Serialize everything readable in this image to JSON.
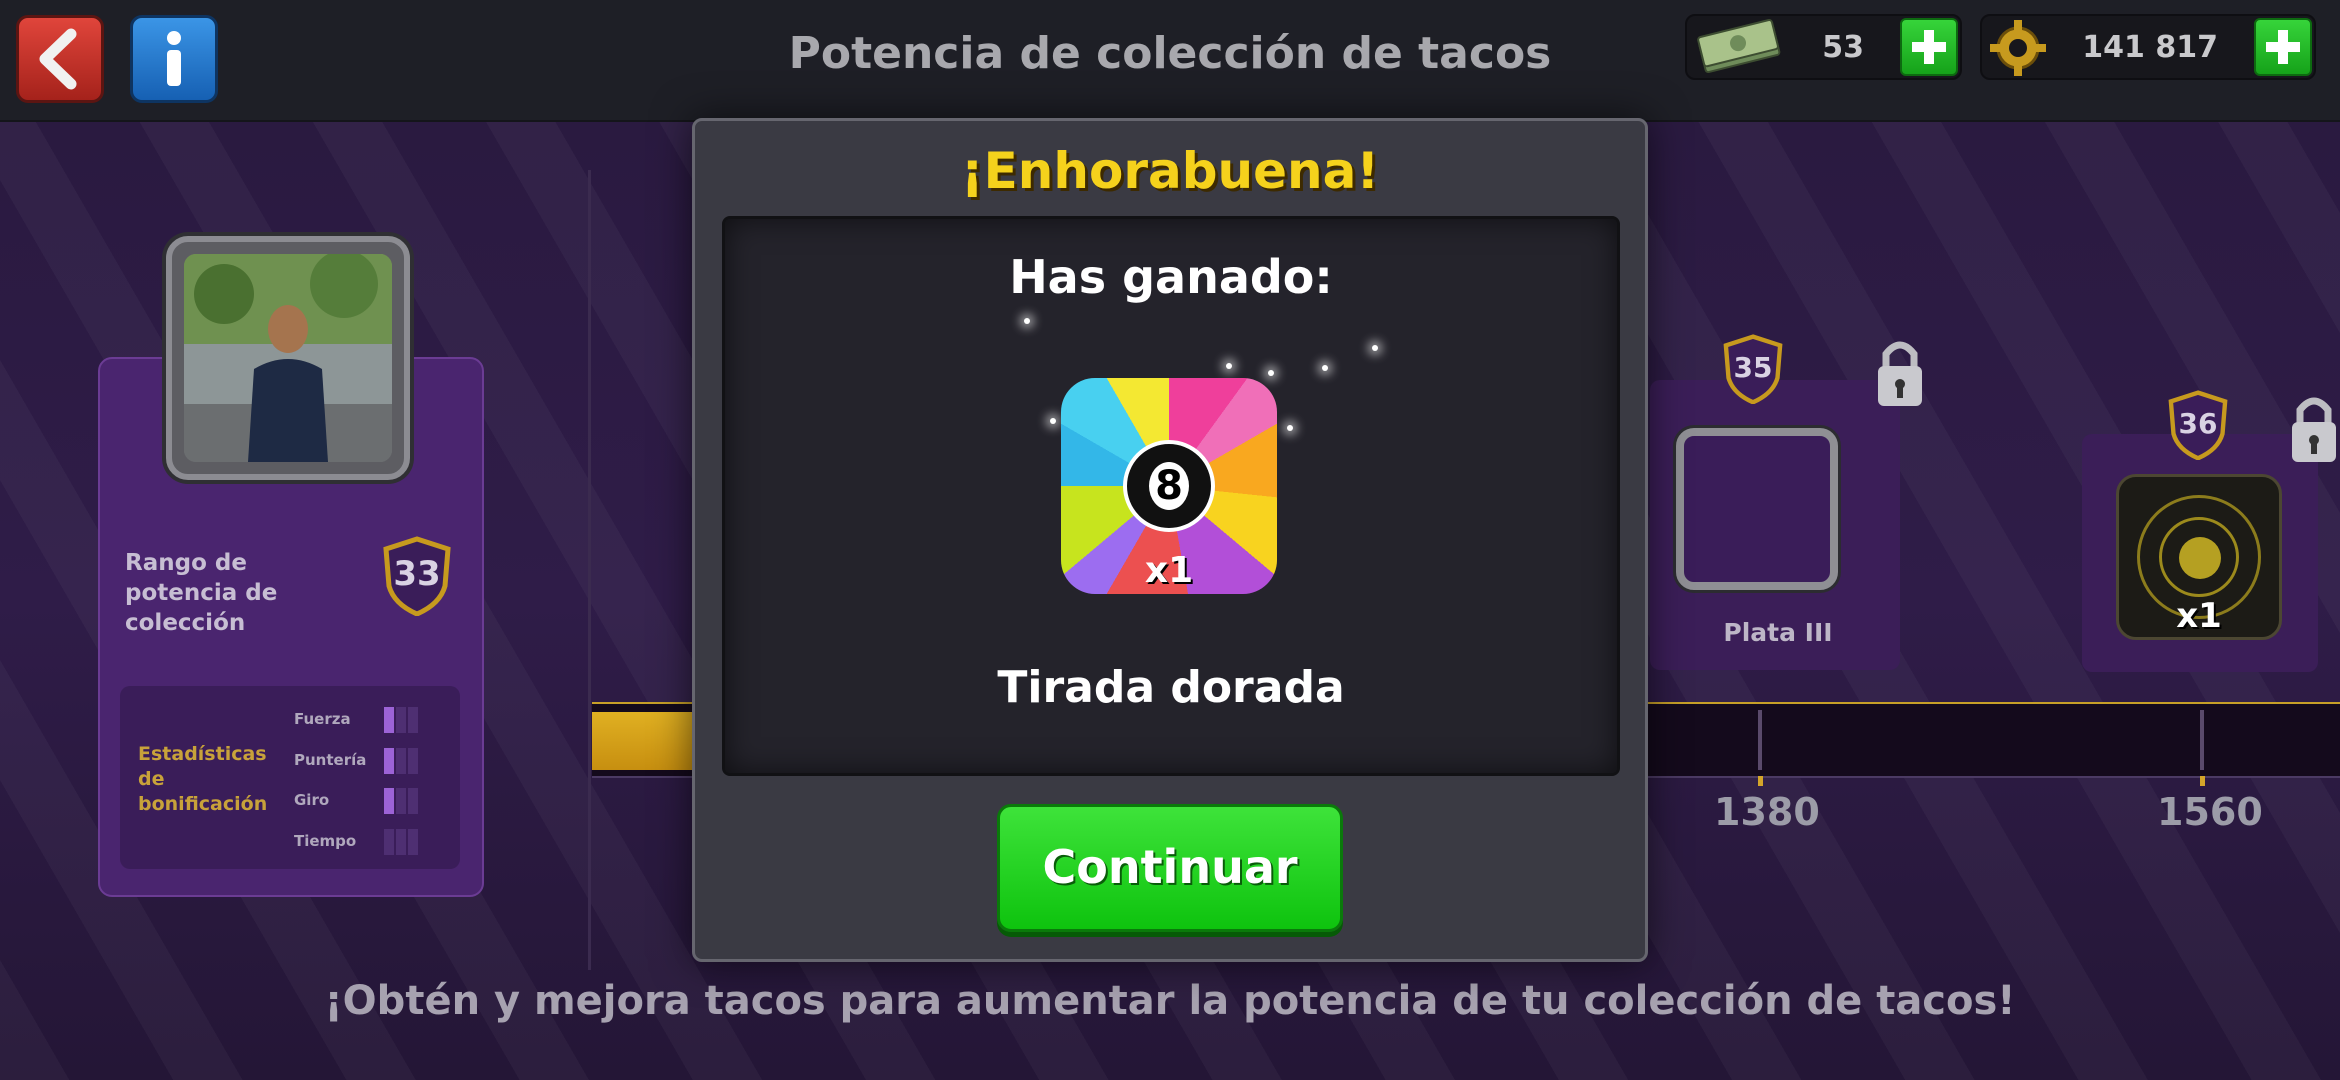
{
  "header": {
    "title": "Potencia de colección de tacos",
    "cash": "53",
    "coins": "141 817"
  },
  "profile": {
    "rank_label": "Rango de potencia de colección",
    "rank_value": "33",
    "bonus_label": "Estadísticas de bonificación",
    "stats": [
      {
        "name": "Fuerza",
        "level": 1
      },
      {
        "name": "Puntería",
        "level": 1
      },
      {
        "name": "Giro",
        "level": 1
      },
      {
        "name": "Tiempo",
        "level": 0
      }
    ]
  },
  "track": {
    "milestones": [
      {
        "value": "1380",
        "level": "35",
        "reward": "Plata III"
      },
      {
        "value": "1560",
        "level": "36",
        "reward_qty": "x1"
      }
    ]
  },
  "modal": {
    "title": "¡Enhorabuena!",
    "subtitle": "Has ganado:",
    "reward_number": "8",
    "reward_qty": "x1",
    "reward_name": "Tirada dorada",
    "continue_label": "Continuar"
  },
  "footer": {
    "message": "¡Obtén y mejora tacos para aumentar la potencia de tu colección de tacos!"
  },
  "colors": {
    "accent_gold": "#f5d21c",
    "button_green": "#16c516",
    "panel_purple": "#4a256f"
  }
}
